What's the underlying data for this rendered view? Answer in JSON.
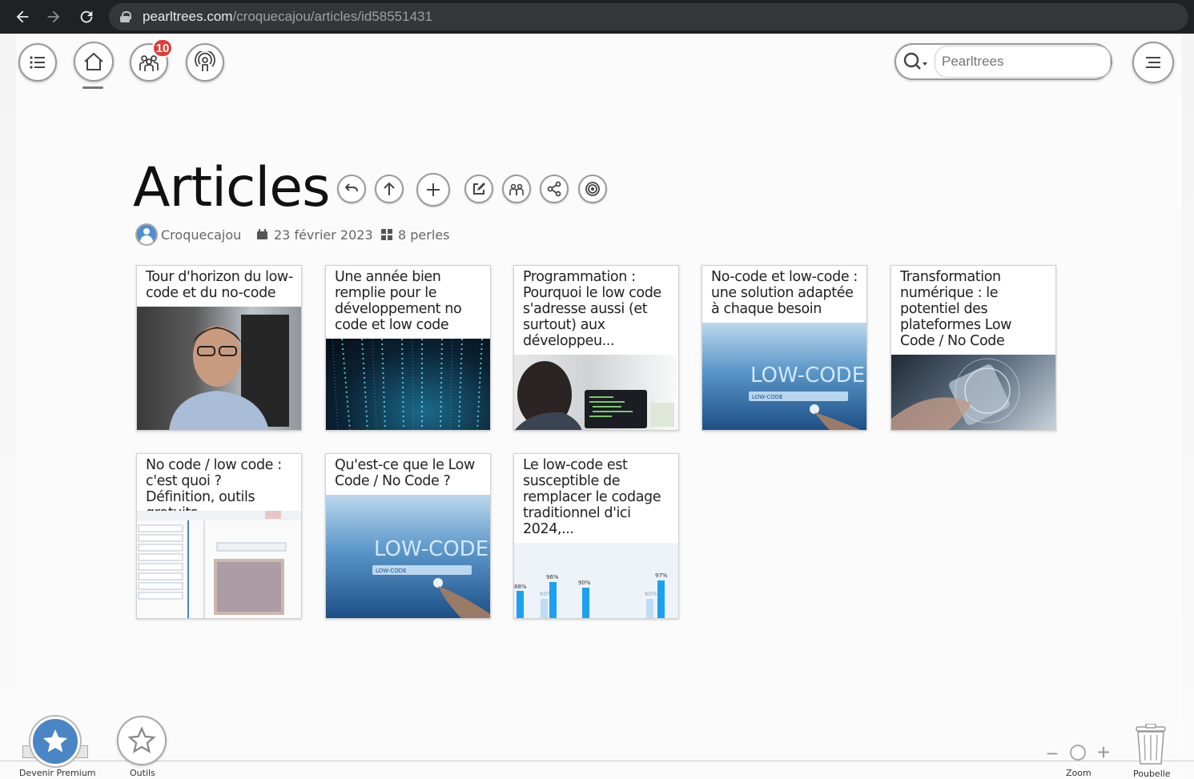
{
  "browser": {
    "url_host": "pearltrees.com",
    "url_path": "/croquecajou/articles/id58551431"
  },
  "header": {
    "notifications_count": "10",
    "search_placeholder": "Pearltrees"
  },
  "collection": {
    "title": "Articles",
    "author": "Croquecajou",
    "date": "23 février 2023",
    "pearl_count": "8 perles"
  },
  "cards": [
    {
      "title": "Tour d'horizon du low-code et du no-code",
      "image": "person-portrait"
    },
    {
      "title": "Une année bien remplie pour le développement no code et low code",
      "image": "digital-matrix"
    },
    {
      "title": "Programmation : Pourquoi le low code s'adresse aussi (et surtout) aux développeu...",
      "image": "developer-at-laptop"
    },
    {
      "title": "No-code et low-code : une solution adaptée à chaque besoin",
      "image": "low-code-search"
    },
    {
      "title": "Transformation numérique : le potentiel des plateformes Low Code / No Code",
      "image": "hand-with-phone"
    },
    {
      "title": "No code / low code : c'est quoi ? Définition, outils gratuits...",
      "image": "app-builder-screenshot"
    },
    {
      "title": "Qu'est-ce que le Low Code / No Code ?",
      "image": "low-code-search"
    },
    {
      "title": "Le low-code est susceptible de remplacer le codage traditionnel d'ici 2024,...",
      "image": "bar-chart"
    }
  ],
  "card_images": {
    "lowcode_text": "LOW-CODE",
    "lowcode_field": "LOW-CODE",
    "chart_labels": [
      "88%",
      "60%",
      "96%",
      "90%",
      "60%",
      "97%"
    ]
  },
  "footer": {
    "premium_label": "Devenir Premium",
    "tools_label": "Outils",
    "zoom_label": "Zoom",
    "trash_label": "Poubelle"
  },
  "colors": {
    "accent_blue": "#4a86c5",
    "badge_red": "#e53935"
  }
}
